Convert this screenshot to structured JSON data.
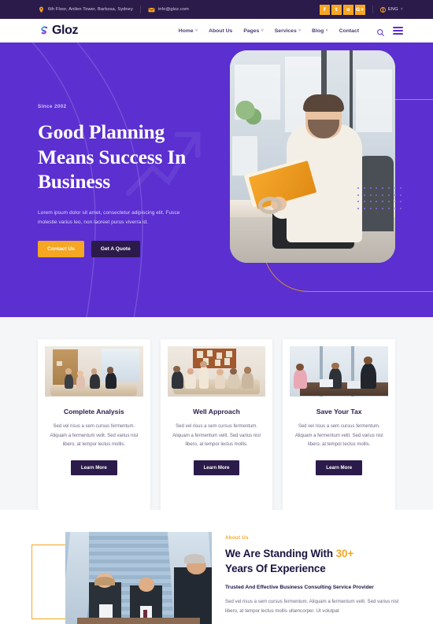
{
  "topbar": {
    "address": "6th Floor, Anilen Tower, Barbosa, Sydney",
    "email": "info@gloz.com",
    "address_icon": "location-pin-icon",
    "email_icon": "envelope-icon",
    "socials": [
      {
        "name": "facebook",
        "glyph": "f"
      },
      {
        "name": "twitter",
        "glyph": "t"
      },
      {
        "name": "instagram",
        "glyph": "o"
      },
      {
        "name": "google-plus",
        "glyph": "G+"
      }
    ],
    "language": "ENG",
    "language_caret": "˅",
    "bg_color": "#2B1B4A",
    "social_color": "#F5A623"
  },
  "nav": {
    "logo_text": "Gloz",
    "logo_icon": "gloz-swirl-logo",
    "items": [
      {
        "label": "Home",
        "has_caret": true
      },
      {
        "label": "About Us",
        "has_caret": false
      },
      {
        "label": "Pages",
        "has_caret": true
      },
      {
        "label": "Services",
        "has_caret": true
      },
      {
        "label": "Blog",
        "has_caret": true
      },
      {
        "label": "Contact",
        "has_caret": false
      }
    ],
    "caret": "˅",
    "search_icon": "search-icon",
    "menu_icon": "hamburger-menu-icon"
  },
  "hero": {
    "eyebrow": "Since 2002",
    "title_line1": "Good Planning",
    "title_line2": "Means Success In",
    "title_line3": "Business",
    "paragraph": "Lorem ipsum dolor sit amet, consectetur adipiscing elit. Fusce molestie varius leo, non laoreet purus viverra id.",
    "primary_button": "Contact Us",
    "secondary_button": "Get A Quote",
    "bg_color": "#5B2FD0",
    "accent_color": "#F5A623",
    "image_alt": "smiling businessman holding an orange book in an office"
  },
  "services": {
    "cards": [
      {
        "title": "Complete Analysis",
        "text": "Sed vel risus a sem cursus fermentum. Aliquam a fermentum velit. Sed varius nisl libero, at tempor lectus mollis.",
        "button": "Learn More",
        "image_alt": "team meeting in a modern office boardroom"
      },
      {
        "title": "Well Approach",
        "text": "Sed vel risus a sem cursus fermentum. Aliquam a fermentum velit. Sed varius nisl libero, at tempor lectus mollis.",
        "button": "Learn More",
        "image_alt": "colleagues around a table with sticky-note board"
      },
      {
        "title": "Save Your Tax",
        "text": "Sed vel risus a sem cursus fermentum. Aliquam a fermentum velit. Sed varius nisl libero, at tempor lectus mollis.",
        "button": "Learn More",
        "image_alt": "business women working with laptops by a window"
      }
    ],
    "bg_color": "#F5F6F8"
  },
  "about": {
    "eyebrow": "About Us",
    "title_prefix": "We Are Standing With ",
    "title_highlight": "30+",
    "title_line2": "Years Of Experience",
    "lead": "Trusted And Effective Business Consulting Service Provider",
    "body": "Sed vel risus a sem cursus fermentum. Aliquam a fermentum velit. Sed varius nisl libero, at tempor lectus mollis ullamcorper. Ut volutpat",
    "image_alt": "three business professionals talking outside a glass office tower",
    "accent_color": "#F5A623"
  }
}
